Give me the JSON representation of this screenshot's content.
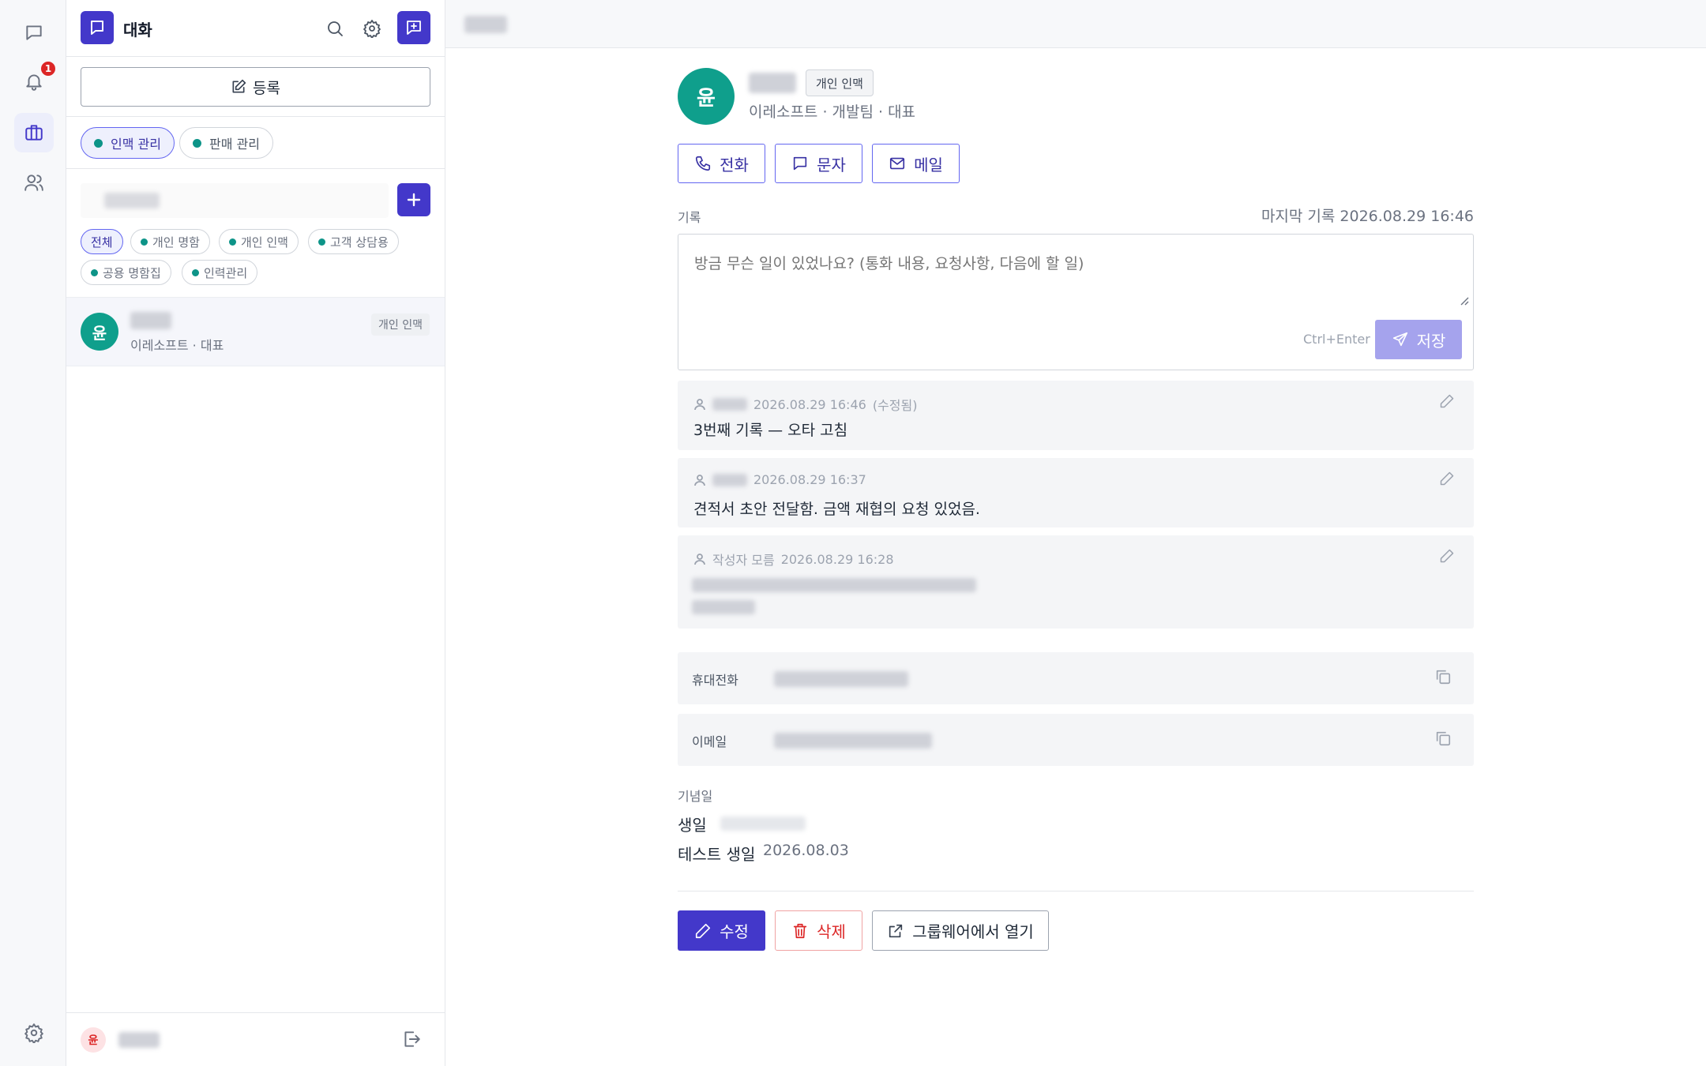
{
  "rail": {
    "notification_count": "1"
  },
  "sidebar": {
    "title": "대화",
    "register_label": "등록",
    "workspace_tabs": [
      {
        "label": "인맥 관리"
      },
      {
        "label": "판매 관리"
      }
    ],
    "filter_chips": [
      {
        "label": "전체"
      },
      {
        "label": "개인 명함"
      },
      {
        "label": "개인 인맥"
      },
      {
        "label": "고객 상담용"
      },
      {
        "label": "공용 명함집"
      },
      {
        "label": "인력관리"
      }
    ],
    "contacts": [
      {
        "avatar": "윤",
        "subtitle": "이레소프트 · 대표",
        "tag": "개인 인맥"
      }
    ],
    "me_avatar": "윤"
  },
  "detail": {
    "avatar": "윤",
    "tag": "개인 인맥",
    "subtitle": "이레소프트 · 개발팀 · 대표",
    "actions": {
      "call": "전화",
      "sms": "문자",
      "mail": "메일"
    },
    "record_label": "기록",
    "last_record": "마지막 기록 2026.08.29 16:46",
    "note_placeholder": "방금 무슨 일이 있었나요? (통화 내용, 요청사항, 다음에 할 일)",
    "shortcut": "Ctrl+Enter",
    "save_label": "저장",
    "logs": [
      {
        "author": "",
        "timestamp": "2026.08.29 16:46",
        "edited": "(수정됨)",
        "text": "3번째 기록 — 오타 고침"
      },
      {
        "author": "",
        "timestamp": "2026.08.29 16:37",
        "edited": "",
        "text": "견적서 초안 전달함. 금액 재협의 요청 있었음."
      },
      {
        "author": "작성자 모름",
        "timestamp": "2026.08.29 16:28",
        "edited": "",
        "text": ""
      }
    ],
    "fields": {
      "phone_label": "휴대전화",
      "email_label": "이메일"
    },
    "anniversary_label": "기념일",
    "anniversaries": [
      {
        "name": "생일",
        "date": ""
      },
      {
        "name": "테스트 생일",
        "date": "2026.08.03"
      }
    ],
    "buttons": {
      "edit": "수정",
      "delete": "삭제",
      "open_groupware": "그룹웨어에서 열기"
    }
  },
  "colors": {
    "accent": "#4338ca",
    "teal": "#0f9f8c",
    "danger": "#dc2626"
  }
}
